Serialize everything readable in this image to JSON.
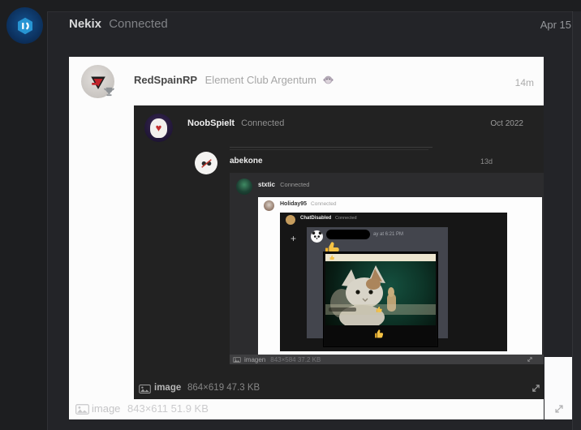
{
  "header": {
    "app_name": "Nekix",
    "status": "Connected",
    "date": "Apr 15"
  },
  "card1": {
    "author": "RedSpainRP",
    "context": "Element Club Argentum",
    "time": "14m",
    "footer": {
      "label": "image",
      "size_text": "843×611 51.9 KB"
    }
  },
  "card2": {
    "author": "NoobSpielt",
    "status": "Connected",
    "date": "Oct 2022",
    "footer": {
      "label": "image",
      "size_text": "864×619 47.3 KB"
    }
  },
  "card3": {
    "author": "abekone",
    "time": "13d"
  },
  "card4": {
    "author": "stxtic",
    "status": "Connected",
    "footer": {
      "label": "imagen",
      "size_text": "843×584 37.2 KB"
    }
  },
  "card5": {
    "author": "Holiday95",
    "status": "Connected"
  },
  "card6": {
    "author": "ChatDisabled",
    "status": "Connected"
  },
  "chat": {
    "timestamp": "ay at 6:21 PM",
    "plus_glyph": "+"
  },
  "icons": {
    "attachment": "image-icon",
    "expand": "expand-diagonal-icon",
    "reaction": "thumbs-up-icon",
    "badge": "trophy-icon",
    "emoji_after_context": "monkey-emoji"
  },
  "colors": {
    "outer_bg": "#232428",
    "card_bg": "#fcfcfc",
    "dark_shot_bg": "#222222",
    "chat_bg": "#43454d",
    "thumb_gold": "#f2b42e",
    "logo_blue": "#2795d3"
  }
}
